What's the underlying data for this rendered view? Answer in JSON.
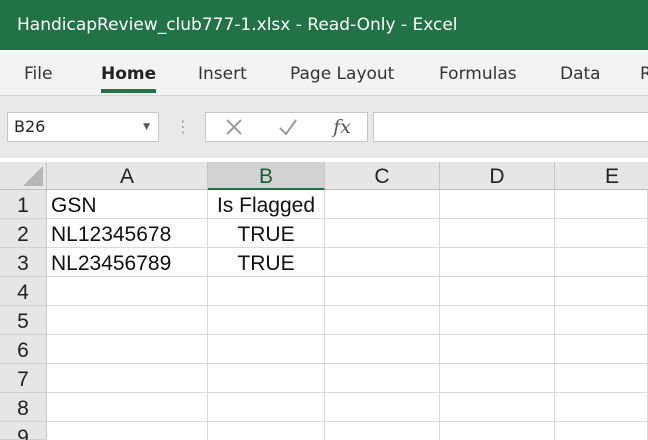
{
  "window": {
    "title": "HandicapReview_club777-1.xlsx  -  Read-Only  -  Excel",
    "accent_color": "#217346"
  },
  "ribbon": {
    "tabs": [
      {
        "label": "File",
        "active": false
      },
      {
        "label": "Home",
        "active": true
      },
      {
        "label": "Insert",
        "active": false
      },
      {
        "label": "Page Layout",
        "active": false
      },
      {
        "label": "Formulas",
        "active": false
      },
      {
        "label": "Data",
        "active": false
      },
      {
        "label": "R",
        "active": false
      }
    ]
  },
  "formula_bar": {
    "name_box": "B26",
    "cancel_icon": "close-icon",
    "enter_icon": "check-icon",
    "fx_label": "fx",
    "formula_value": ""
  },
  "sheet": {
    "columns": [
      "A",
      "B",
      "C",
      "D",
      "E"
    ],
    "selected_column": "B",
    "rows": [
      "1",
      "2",
      "3",
      "4",
      "5",
      "6",
      "7",
      "8",
      "9"
    ],
    "cells": [
      [
        "GSN",
        "Is Flagged",
        "",
        "",
        ""
      ],
      [
        "NL12345678",
        "TRUE",
        "",
        "",
        ""
      ],
      [
        "NL23456789",
        "TRUE",
        "",
        "",
        ""
      ],
      [
        "",
        "",
        "",
        "",
        ""
      ],
      [
        "",
        "",
        "",
        "",
        ""
      ],
      [
        "",
        "",
        "",
        "",
        ""
      ],
      [
        "",
        "",
        "",
        "",
        ""
      ],
      [
        "",
        "",
        "",
        "",
        ""
      ],
      [
        "",
        "",
        "",
        "",
        ""
      ]
    ]
  }
}
